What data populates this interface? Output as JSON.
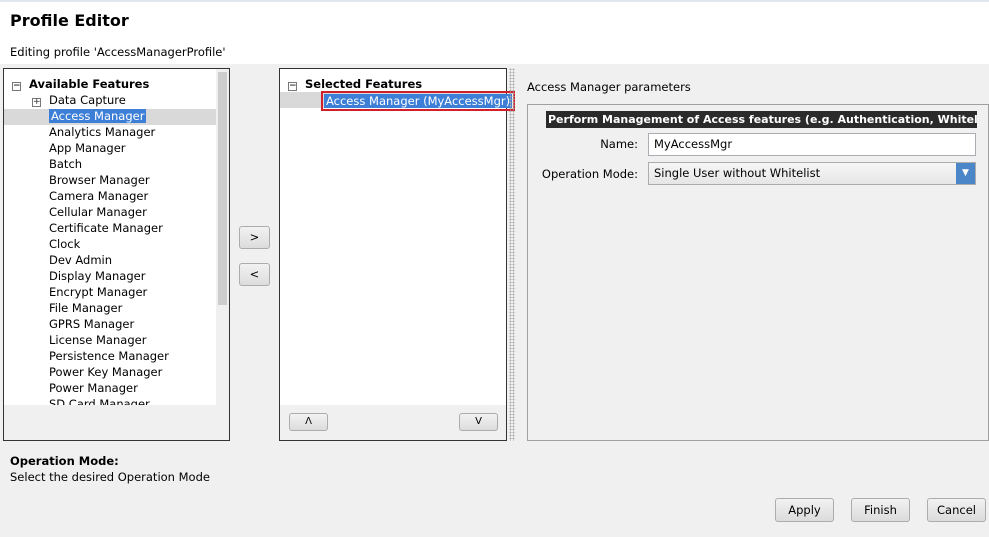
{
  "header": {
    "title": "Profile Editor",
    "subtitle": "Editing profile 'AccessManagerProfile'"
  },
  "available": {
    "root": "Available Features",
    "items": [
      "Data Capture",
      "Access Manager",
      "Analytics Manager",
      "App Manager",
      "Batch",
      "Browser Manager",
      "Camera Manager",
      "Cellular Manager",
      "Certificate Manager",
      "Clock",
      "Dev Admin",
      "Display Manager",
      "Encrypt Manager",
      "File Manager",
      "GPRS Manager",
      "License Manager",
      "Persistence Manager",
      "Power Key Manager",
      "Power Manager",
      "SD Card Manager"
    ],
    "selected_index": 1
  },
  "transfer": {
    "add": ">",
    "remove": "<"
  },
  "selected": {
    "root": "Selected Features",
    "items": [
      "Access Manager (MyAccessMgr)"
    ],
    "up": "Λ",
    "down": "V",
    "highlight_color": "#d0202c"
  },
  "params": {
    "title": "Access Manager parameters",
    "group_header": "Perform Management of Access features (e.g. Authentication, Whitelist, etc.)",
    "name_label": "Name:",
    "name_value": "MyAccessMgr",
    "mode_label": "Operation Mode:",
    "mode_value": "Single User without Whitelist"
  },
  "help": {
    "title": "Operation Mode:",
    "text": "Select the desired Operation Mode"
  },
  "footer": {
    "apply": "Apply",
    "finish": "Finish",
    "cancel": "Cancel"
  },
  "colors": {
    "selection": "#3d7fd6",
    "group_header_bg": "#2b2b2b"
  }
}
